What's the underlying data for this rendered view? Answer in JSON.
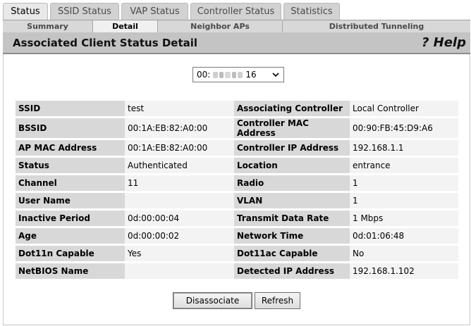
{
  "main_tabs": [
    {
      "label": "Status",
      "active": true
    },
    {
      "label": "SSID Status",
      "active": false
    },
    {
      "label": "VAP Status",
      "active": false
    },
    {
      "label": "Controller Status",
      "active": false
    },
    {
      "label": "Statistics",
      "active": false
    }
  ],
  "sub_tabs": [
    {
      "label": "Summary",
      "active": false
    },
    {
      "label": "Detail",
      "active": true
    },
    {
      "label": "Neighbor APs",
      "active": false
    },
    {
      "label": "Distributed Tunneling",
      "active": false
    }
  ],
  "header": {
    "title": "Associated Client Status Detail",
    "help": "? Help"
  },
  "client_select": {
    "prefix": "00:",
    "suffix": "16"
  },
  "rows": [
    {
      "l1": "SSID",
      "v1": "test",
      "l2": "Associating Controller",
      "v2": "Local Controller"
    },
    {
      "l1": "BSSID",
      "v1": "00:1A:EB:82:A0:00",
      "l2": "Controller MAC Address",
      "v2": "00:90:FB:45:D9:A6"
    },
    {
      "l1": "AP MAC Address",
      "v1": "00:1A:EB:82:A0:00",
      "l2": "Controller IP Address",
      "v2": "192.168.1.1"
    },
    {
      "l1": "Status",
      "v1": "Authenticated",
      "l2": "Location",
      "v2": "entrance"
    },
    {
      "l1": "Channel",
      "v1": "11",
      "l2": "Radio",
      "v2": "1"
    },
    {
      "l1": "User Name",
      "v1": "",
      "l2": "VLAN",
      "v2": "1"
    },
    {
      "l1": "Inactive Period",
      "v1": "0d:00:00:04",
      "l2": "Transmit Data Rate",
      "v2": "1 Mbps"
    },
    {
      "l1": "Age",
      "v1": "0d:00:00:02",
      "l2": "Network Time",
      "v2": "0d:01:06:48"
    },
    {
      "l1": "Dot11n Capable",
      "v1": "Yes",
      "l2": "Dot11ac Capable",
      "v2": "No"
    },
    {
      "l1": "NetBIOS Name",
      "v1": "",
      "l2": "Detected IP Address",
      "v2": "192.168.1.102"
    }
  ],
  "buttons": {
    "disassociate": "Disassociate",
    "refresh": "Refresh"
  }
}
